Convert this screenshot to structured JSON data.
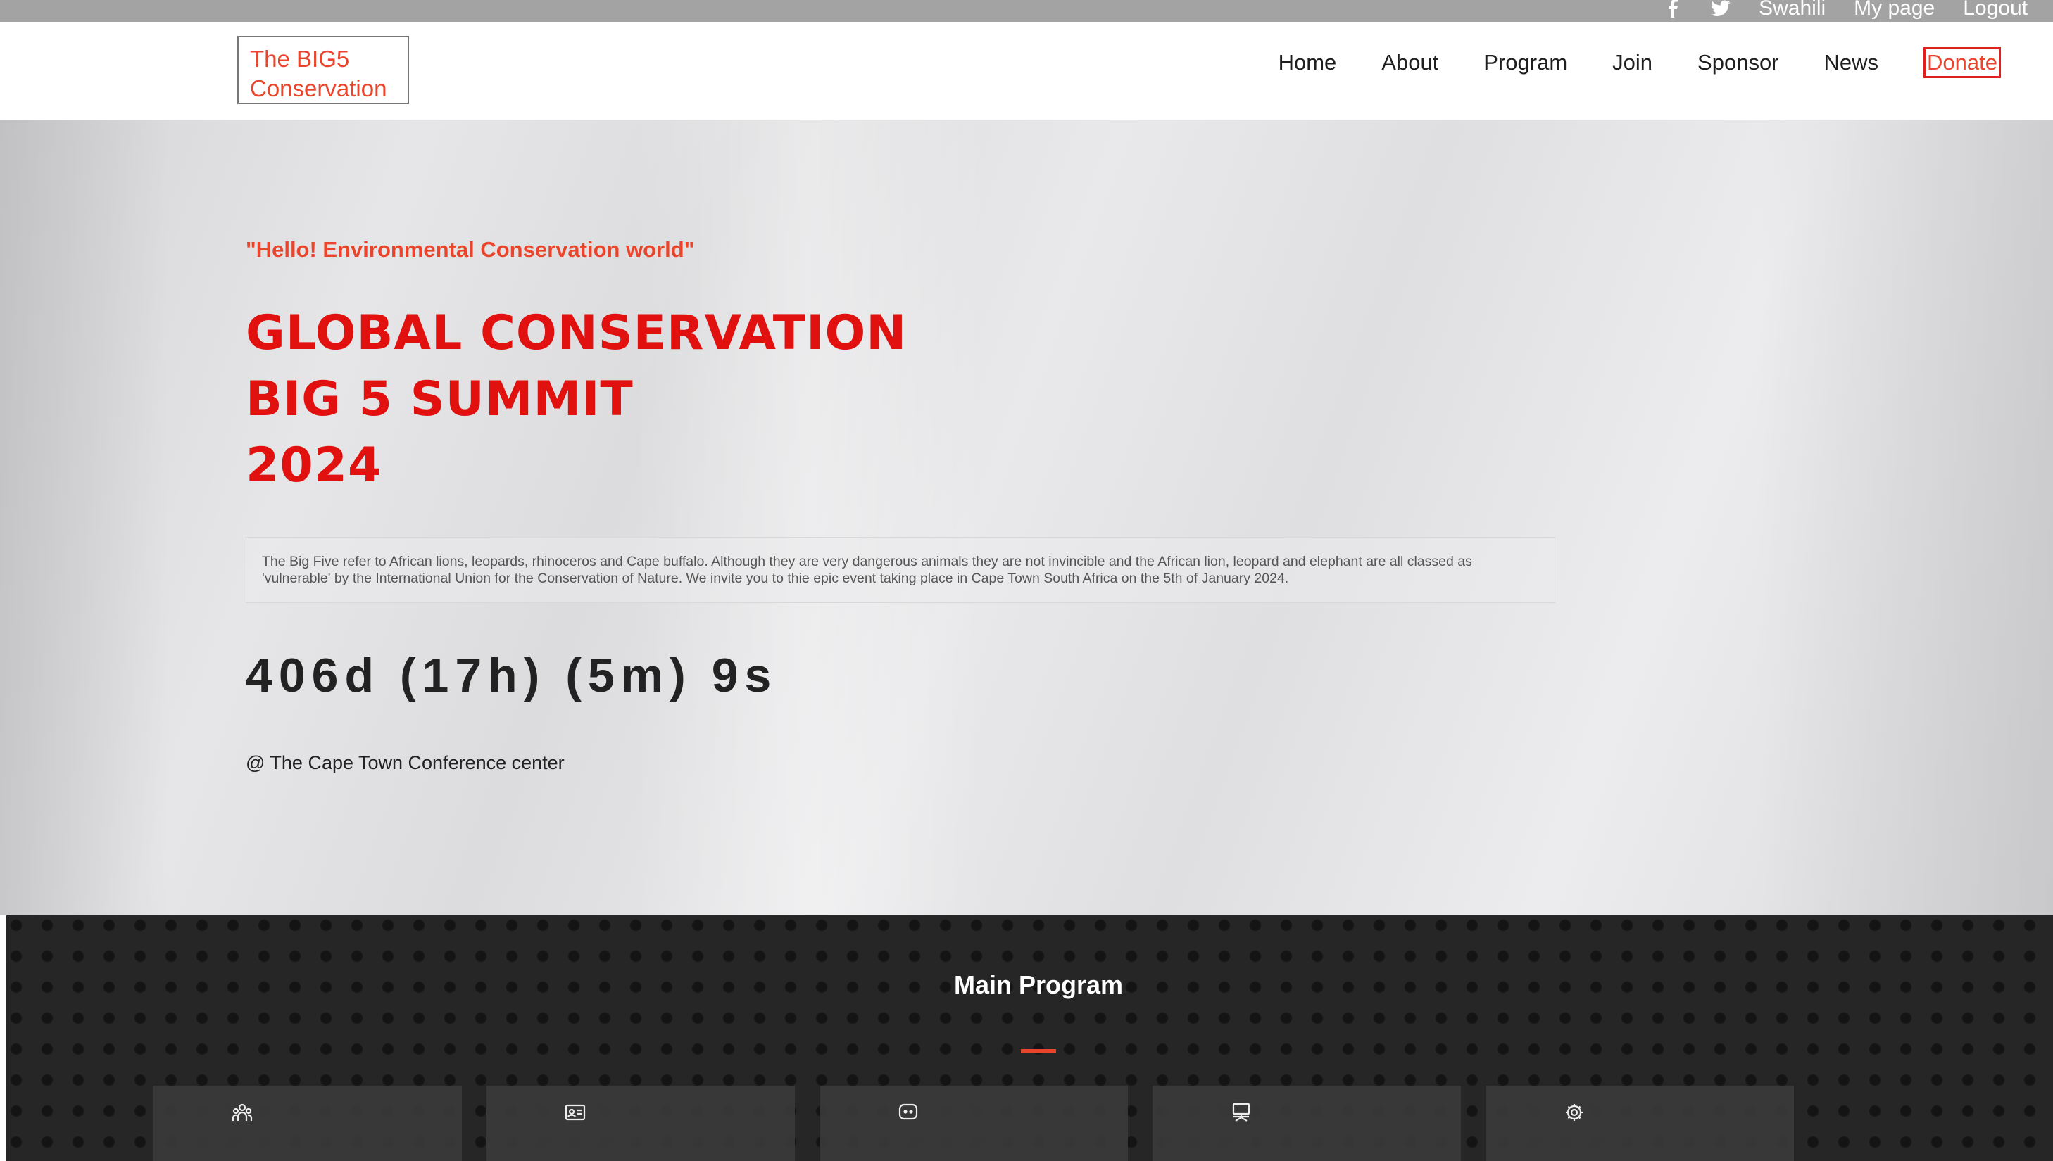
{
  "topbar": {
    "social": [
      {
        "icon": "facebook-icon",
        "glyph": "f"
      },
      {
        "icon": "twitter-icon",
        "glyph": "t"
      }
    ],
    "links": [
      "Swahili",
      "My page",
      "Logout"
    ]
  },
  "header": {
    "logo_line1": "The BIG5",
    "logo_line2": "Conservation",
    "nav": [
      "Home",
      "About",
      "Program",
      "Join",
      "Sponsor",
      "News"
    ],
    "donate": "Donate"
  },
  "hero": {
    "greeting": "\"Hello! Environmental Conservation world\"",
    "title_lines": [
      "GLOBAL CONSERVATION",
      "BIG 5 SUMMIT",
      "2024"
    ],
    "description": "The Big Five refer to African lions, leopards, rhinoceros and Cape buffalo. Although they are very dangerous animals they are not invincible and the African lion, leopard and elephant are all classed as 'vulnerable' by the International Union for the Conservation of Nature. We invite you to thie epic event taking place in Cape Town South Africa on the 5th of January 2024.",
    "countdown": "406d (17h) (5m) 9s",
    "venue": "@ The Cape Town Conference center"
  },
  "program": {
    "title": "Main Program",
    "cards": [
      {
        "icon": "people-icon"
      },
      {
        "icon": "id-card-icon"
      },
      {
        "icon": "chat-icon"
      },
      {
        "icon": "presentation-icon"
      },
      {
        "icon": "gear-icon"
      }
    ]
  },
  "colors": {
    "accent": "#e8452c",
    "title_red": "#e0110f",
    "topbar": "#a3a3a4",
    "program_bg": "#262626"
  }
}
